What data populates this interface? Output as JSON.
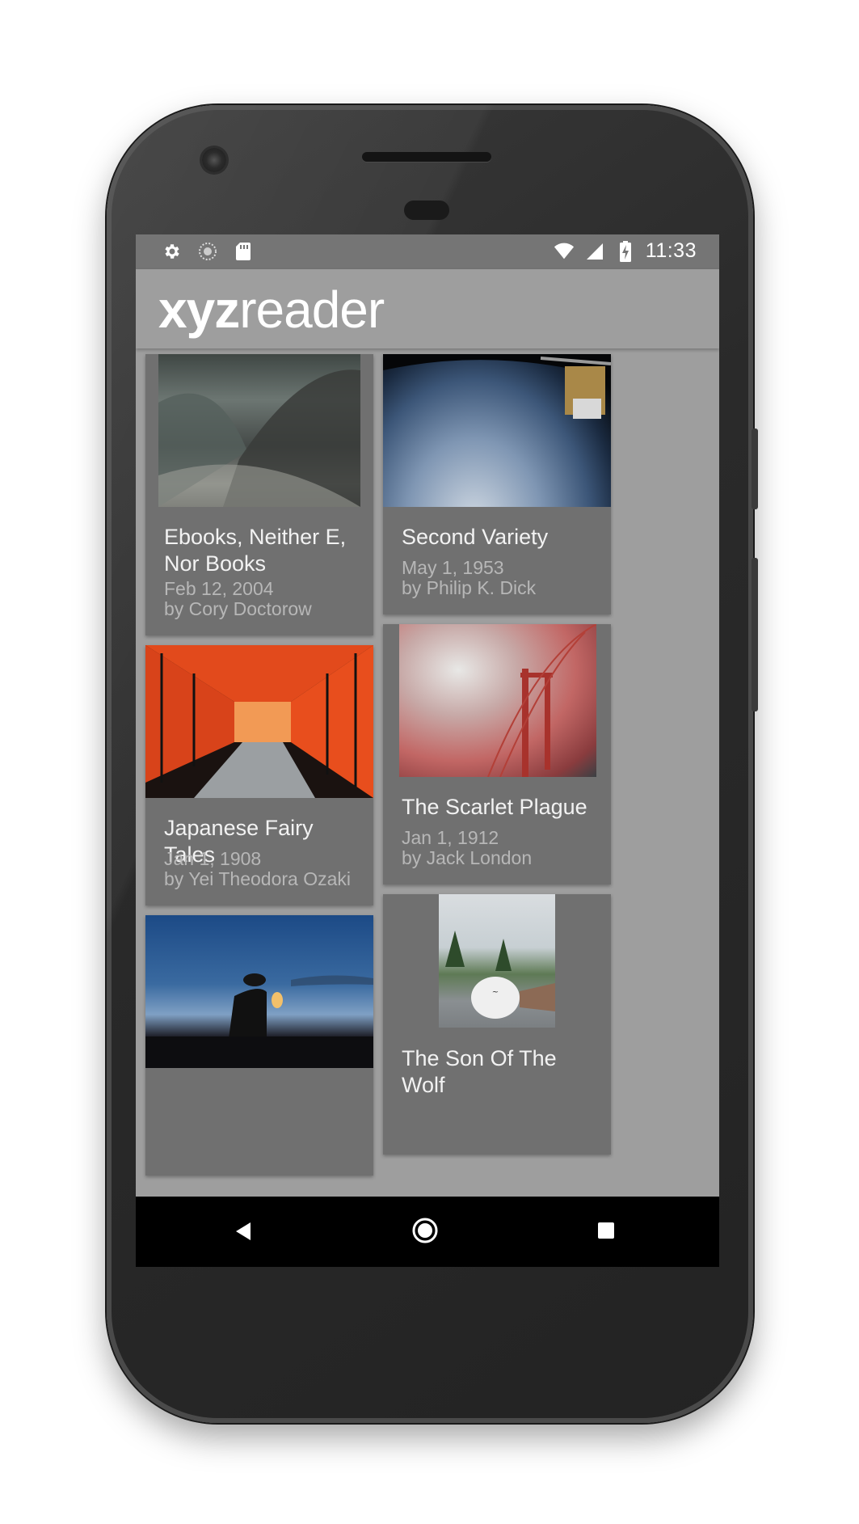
{
  "app": {
    "logo_bold": "xyz",
    "logo_light": "reader"
  },
  "status_bar": {
    "time": "11:33",
    "left_icons": [
      "gear-icon",
      "sync-icon",
      "sd-card-icon"
    ],
    "right_icons": [
      "wifi-icon",
      "cell-signal-icon",
      "battery-charging-icon"
    ]
  },
  "articles": [
    {
      "title": "Ebooks, Neither E, Nor Books",
      "date": "Feb 12, 2004",
      "author": "by Cory Doctorow"
    },
    {
      "title": "Second Variety",
      "date": "May 1, 1953",
      "author": "by Philip K. Dick"
    },
    {
      "title": "Japanese Fairy Tales",
      "date": "Jan 1, 1908",
      "author": "by Yei Theodora Ozaki"
    },
    {
      "title": "The Scarlet Plague",
      "date": "Jan 1, 1912",
      "author": "by Jack London"
    },
    {
      "title": "",
      "date": "",
      "author": ""
    },
    {
      "title": "The Son Of The Wolf",
      "date": "",
      "author": ""
    }
  ],
  "nav_bar": {
    "buttons": [
      "back-icon",
      "home-icon",
      "recents-icon"
    ]
  },
  "colors": {
    "status_bar": "#757575",
    "toolbar": "#9e9e9e",
    "card": "#707070",
    "nav_bar": "#000000"
  }
}
